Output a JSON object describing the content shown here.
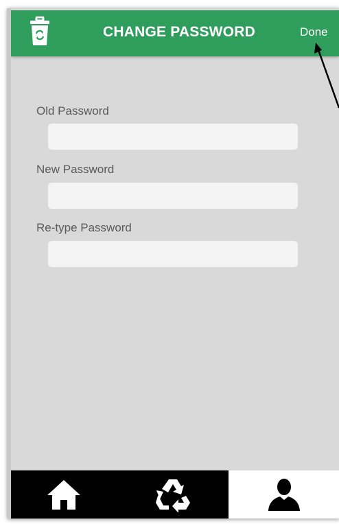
{
  "header": {
    "title": "CHANGE PASSWORD",
    "done_label": "Done",
    "app_icon": "trash-recycle-icon",
    "background_color": "#2f9e5d"
  },
  "form": {
    "fields": [
      {
        "label": "Old Password",
        "value": "",
        "placeholder": ""
      },
      {
        "label": "New Password",
        "value": "",
        "placeholder": ""
      },
      {
        "label": "Re-type Password",
        "value": "",
        "placeholder": ""
      }
    ]
  },
  "bottom_nav": {
    "items": [
      {
        "icon": "home-icon",
        "active": false
      },
      {
        "icon": "recycle-icon",
        "active": false
      },
      {
        "icon": "user-icon",
        "active": true
      }
    ]
  },
  "colors": {
    "accent": "#2f9e5d",
    "body_background": "#d9d9d9",
    "input_background": "#f4f4f4",
    "nav_background": "#000000",
    "nav_active_background": "#ffffff"
  }
}
